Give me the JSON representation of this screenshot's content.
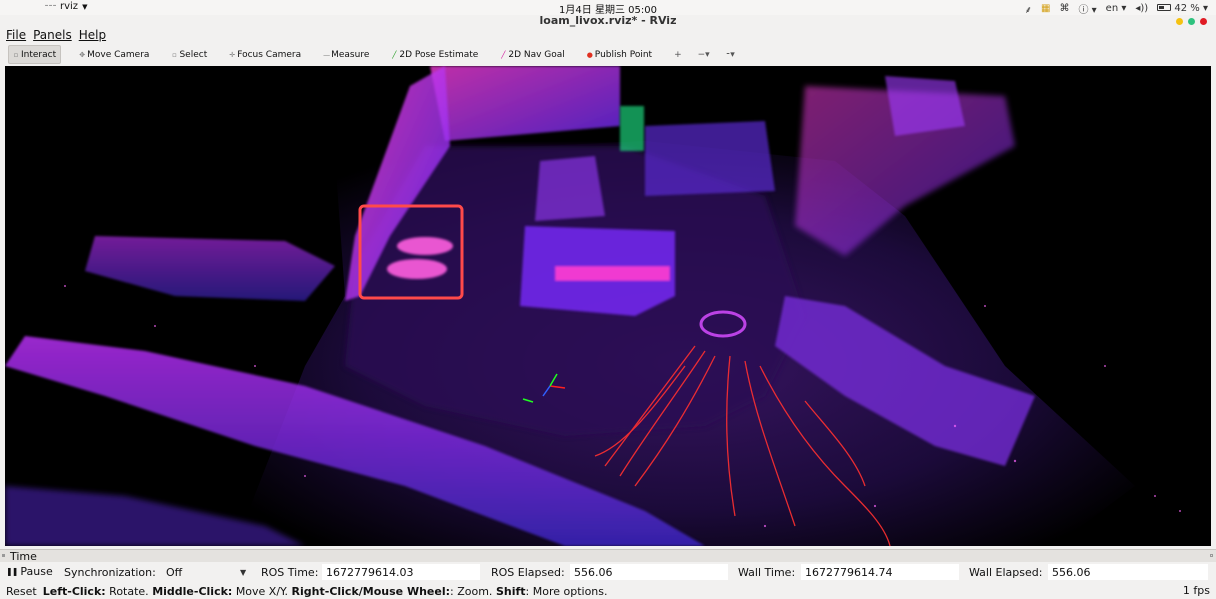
{
  "system": {
    "app_menu": "rviz",
    "clock": "1月4日 星期三  05:00",
    "language": "en",
    "battery": "42 %"
  },
  "window": {
    "title": "loam_livox.rviz* - RViz"
  },
  "menubar": {
    "file": "File",
    "panels": "Panels",
    "help": "Help"
  },
  "toolbar": {
    "tools": [
      {
        "label": "Interact",
        "icon": "interact-icon"
      },
      {
        "label": "Move Camera",
        "icon": "move-camera-icon"
      },
      {
        "label": "Select",
        "icon": "select-icon"
      },
      {
        "label": "Focus Camera",
        "icon": "focus-camera-icon"
      },
      {
        "label": "Measure",
        "icon": "measure-icon"
      },
      {
        "label": "2D Pose Estimate",
        "icon": "pose-estimate-icon",
        "color": "#1d9a1d"
      },
      {
        "label": "2D Nav Goal",
        "icon": "nav-goal-icon",
        "color": "#d0109a"
      },
      {
        "label": "Publish Point",
        "icon": "publish-point-icon",
        "color": "#e03020"
      }
    ],
    "active_tool": "Interact"
  },
  "time_panel": {
    "title": "Time",
    "pause_label": "Pause",
    "sync_label": "Synchronization:",
    "sync_value": "Off",
    "ros_time_label": "ROS Time:",
    "ros_time": "1672779614.03",
    "ros_elapsed_label": "ROS Elapsed:",
    "ros_elapsed": "556.06",
    "wall_time_label": "Wall Time:",
    "wall_time": "1672779614.74",
    "wall_elapsed_label": "Wall Elapsed:",
    "wall_elapsed": "556.06"
  },
  "statusbar": {
    "reset": "Reset",
    "left_click": "Left-Click:",
    "left_click_desc": "Rotate.",
    "middle_click": "Middle-Click:",
    "middle_click_desc": "Move X/Y.",
    "right_click": "Right-Click/Mouse Wheel:",
    "right_click_desc": ": Zoom.",
    "shift": "Shift",
    "shift_desc": ": More options.",
    "fps": "1 fps"
  },
  "viewport": {
    "background": "#000000",
    "point_colors": [
      "#ff2fd8",
      "#b020ff",
      "#6a2bff",
      "#3d28c8"
    ],
    "trajectory_color": "#ff3030",
    "highlight_color": "#ff4a4a"
  }
}
